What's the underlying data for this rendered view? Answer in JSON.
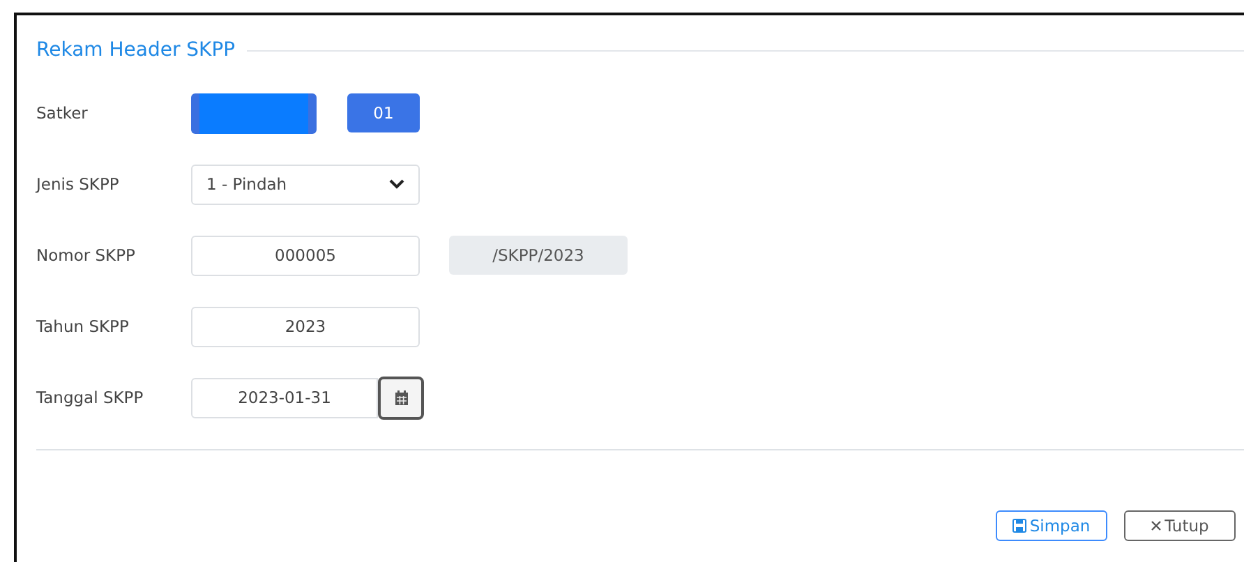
{
  "form": {
    "title": "Rekam Header SKPP",
    "fields": [
      {
        "kind": "satker",
        "label": "Satker",
        "code": "01"
      },
      {
        "kind": "select",
        "label": "Jenis SKPP",
        "value": "1 - Pindah"
      },
      {
        "kind": "suffixed",
        "label": "Nomor SKPP",
        "value": "000005",
        "suffix": "/SKPP/2023"
      },
      {
        "kind": "text",
        "label": "Tahun SKPP",
        "value": "2023"
      },
      {
        "kind": "date",
        "label": "Tanggal SKPP",
        "value": "2023-01-31"
      }
    ]
  },
  "buttons": [
    {
      "kind": "save",
      "label": "Simpan"
    },
    {
      "kind": "close",
      "label": "Tutup"
    }
  ]
}
